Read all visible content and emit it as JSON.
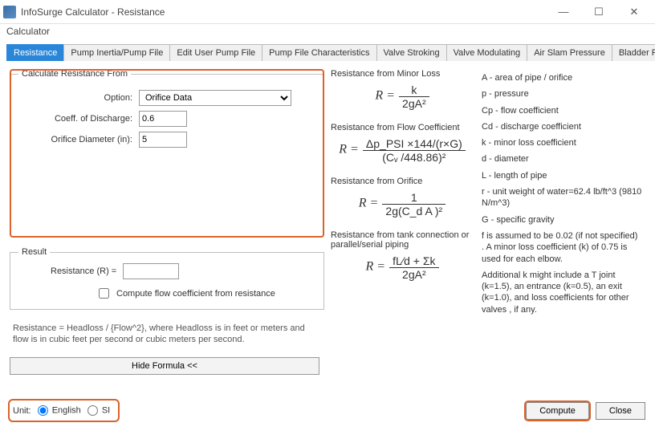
{
  "window": {
    "title": "InfoSurge Calculator - Resistance",
    "minimize": "—",
    "maximize": "☐",
    "close": "✕"
  },
  "menu": {
    "calculator": "Calculator"
  },
  "tabs": {
    "items": [
      "Resistance",
      "Pump Inertia/Pump File",
      "Edit User Pump File",
      "Pump File Characteristics",
      "Valve Stroking",
      "Valve Modulating",
      "Air Slam Pressure",
      "Bladder Pred..."
    ],
    "active_index": 0,
    "scroll_left": "◂",
    "scroll_right": "▸"
  },
  "calc_group": {
    "legend": "Calculate Resistance From",
    "option_label": "Option:",
    "option_value": "Orifice Data",
    "cd_label": "Coeff. of Discharge:",
    "cd_value": "0.6",
    "diam_label": "Orifice Diameter (in):",
    "diam_value": "5"
  },
  "result_group": {
    "legend": "Result",
    "r_label": "Resistance (R)  =",
    "r_value": "",
    "checkbox_label": "Compute flow coefficient from resistance"
  },
  "note": "Resistance = Headloss / {Flow^2}, where Headloss is in feet or meters and flow is in cubic feet per second or cubic meters per second.",
  "hide_formula_btn": "Hide Formula <<",
  "formulas": {
    "minor": {
      "title": "Resistance from Minor Loss",
      "num": "k",
      "den": "2gA²"
    },
    "flowcoef": {
      "title": "Resistance from Flow Coefficient",
      "num": "Δp_PSI ×144/(r×G)",
      "den": "(Cᵥ /448.86)²"
    },
    "orifice": {
      "title": "Resistance from Orifice",
      "num": "1",
      "den": "2g(C_d A )²"
    },
    "tank": {
      "title": "Resistance from tank connection or parallel/serial piping",
      "num": "fL⁄d + Σk",
      "den": "2gA²"
    }
  },
  "legend_defs": {
    "A": "A - area of pipe / orifice",
    "p": "p - pressure",
    "Cp": "Cp - flow coefficient",
    "Cd": "Cd - discharge coefficient",
    "k": "k - minor loss coefficient",
    "d": "d - diameter",
    "L": "L - length of pipe",
    "r": "r - unit weight of water=62.4 lb/ft^3 (9810 N/m^3)",
    "G": "G - specific gravity",
    "f": "f is assumed to be 0.02 (if not specified) . A minor loss coefficient (k) of 0.75 is used for each elbow.",
    "addl": "Additional k might include a T joint (k=1.5), an entrance (k=0.5), an exit (k=1.0), and loss coefficients for other valves , if any."
  },
  "footer": {
    "unit_label": "Unit:",
    "english": "English",
    "si": "SI",
    "compute": "Compute",
    "close": "Close"
  }
}
